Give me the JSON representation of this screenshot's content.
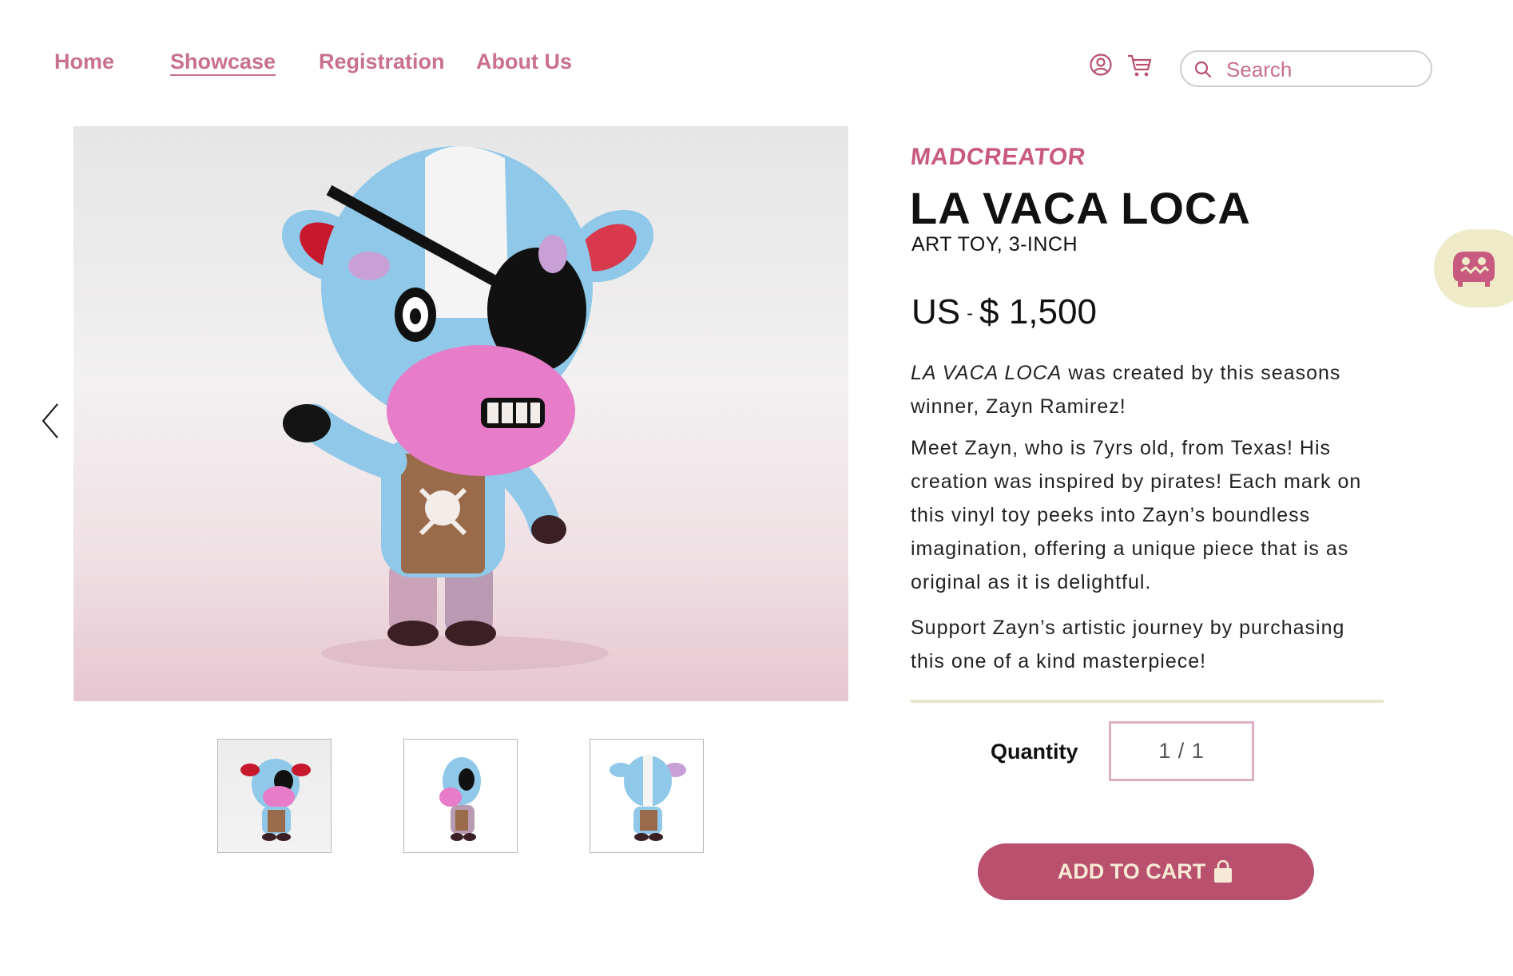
{
  "nav": {
    "home": "Home",
    "showcase": "Showcase",
    "registration": "Registration",
    "about": "About Us"
  },
  "header": {
    "account_icon": "user-circle-icon",
    "cart_icon": "shopping-cart-icon",
    "search_placeholder": "Search"
  },
  "gallery": {
    "thumbnails": [
      "front-view",
      "side-view",
      "back-view"
    ]
  },
  "product": {
    "brand": "MADCREATOR",
    "title": "LA VACA LOCA",
    "subtitle": "ART TOY, 3-INCH",
    "currency": "US",
    "separator": "-",
    "price": "$ 1,500",
    "desc_title": "LA VACA LOCA",
    "desc_p1_rest": " was created by this seasons winner, Zayn Ramirez!",
    "desc_p2": "Meet Zayn, who is 7yrs old, from Texas! His creation was inspired by pirates! Each mark on this vinyl toy peeks into Zayn’s boundless imagination, offering a unique piece that is as original as it is delightful.",
    "desc_p3": "Support Zayn’s artistic journey by purchasing this one of a kind masterpiece!",
    "quantity_label": "Quantity",
    "quantity_value": "1 / 1",
    "add_to_cart": "ADD TO CART"
  },
  "colors": {
    "accent": "#c8708e",
    "brand": "#c85a80",
    "button": "#b8506e",
    "button_text": "#f6ead6",
    "cream": "#efebc8"
  }
}
